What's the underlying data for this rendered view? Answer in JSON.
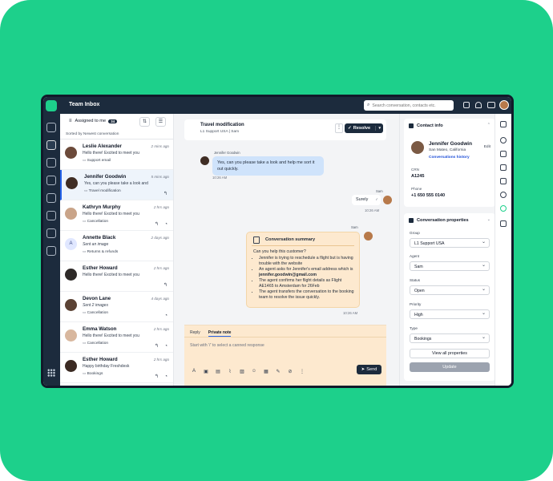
{
  "app": {
    "title": "Team Inbox"
  },
  "search": {
    "placeholder": "Search conversation, contacts etc."
  },
  "list": {
    "header": "Assigned to me",
    "count": "34",
    "sort_label": "Sorted by Newest conversation",
    "items": [
      {
        "name": "Leslie Alexander",
        "time": "2 mins ago",
        "preview": "Hello there! Excited to meet you",
        "tag": "Support email",
        "letter": "",
        "preview_italic": false
      },
      {
        "name": "Jennifer Goodwin",
        "time": "5 mins ago",
        "preview": "Yes, can you please take a look and",
        "tag": "Travel modification",
        "letter": "",
        "preview_italic": false
      },
      {
        "name": "Kathryn Murphy",
        "time": "2 hrs ago",
        "preview": "Hello there! Excited to meet you",
        "tag": "Cancellation",
        "letter": "",
        "preview_italic": false
      },
      {
        "name": "Annette Black",
        "time": "2 days ago",
        "preview": "Sent an image",
        "tag": "Returns & refunds",
        "letter": "A",
        "preview_italic": true
      },
      {
        "name": "Esther Howard",
        "time": "2 hrs ago",
        "preview": "Hello there! Excited to meet you",
        "tag": "",
        "letter": "",
        "preview_italic": false
      },
      {
        "name": "Devon Lane",
        "time": "4 days ago",
        "preview": "Sent 2 images",
        "tag": "Cancellation",
        "letter": "",
        "preview_italic": true
      },
      {
        "name": "Emma Watson",
        "time": "2 hrs ago",
        "preview": "Hello there! Excited to meet you",
        "tag": "Cancellation",
        "letter": "",
        "preview_italic": false
      },
      {
        "name": "Esther Howard",
        "time": "2 hrs ago",
        "preview": "Happy birthday Freshdesk",
        "tag": "Bookings",
        "letter": "",
        "preview_italic": false
      }
    ]
  },
  "chat": {
    "title": "Travel modification",
    "subtitle": "L1 Support USA | Sam",
    "resolve_label": "Resolve",
    "msg1": {
      "sender": "Jennifer Goodwin",
      "text": "Yes, can you please take a look and help me sort it out quickly.",
      "time": "10:26 AM"
    },
    "msg2": {
      "sender": "Sam",
      "text": "Surely",
      "time": "10:26 AM"
    },
    "summary": {
      "sender": "Sam",
      "title": "Conversation summary",
      "question": "Can you help this customer?",
      "bullets": [
        "Jennifer is trying to reschedule a flight but is having trouble with the website",
        "An agent asks for Jennifer's email address which is jennifer.goodwin@gmail.com",
        "The agent confirms her flight details as Flight AE1465 to Amsterdam for 26Feb",
        "The agent transfers the conversation to the booking team to resolve the issue quickly."
      ],
      "time": "10:26 AM"
    },
    "composer": {
      "tab_reply": "Reply",
      "tab_note": "Private note",
      "placeholder": "Start with '/' to select a canned response",
      "send_label": "Send"
    }
  },
  "contact": {
    "header": "Contact info",
    "name": "Jennifer Goodwin",
    "location": "San Mateo, California",
    "history_link": "Conversations history",
    "edit_label": "Edit",
    "crn_label": "CRN",
    "crn_value": "A1245",
    "phone_label": "Phone",
    "phone_value": "+1 650 555 0140"
  },
  "properties": {
    "header": "Conversation properties",
    "group_label": "Group",
    "group_value": "L1 Support USA",
    "agent_label": "Agent",
    "agent_value": "Sam",
    "status_label": "Status",
    "status_value": "Open",
    "priority_label": "Priority",
    "priority_value": "High",
    "type_label": "Type",
    "type_value": "Bookings",
    "view_all": "View all properties",
    "update": "Update"
  },
  "colors": {
    "background": "#1dd08b",
    "nav": "#1c2b3d",
    "accent": "#2563eb",
    "note": "#fde9cf",
    "incoming": "#cfe3fb"
  }
}
